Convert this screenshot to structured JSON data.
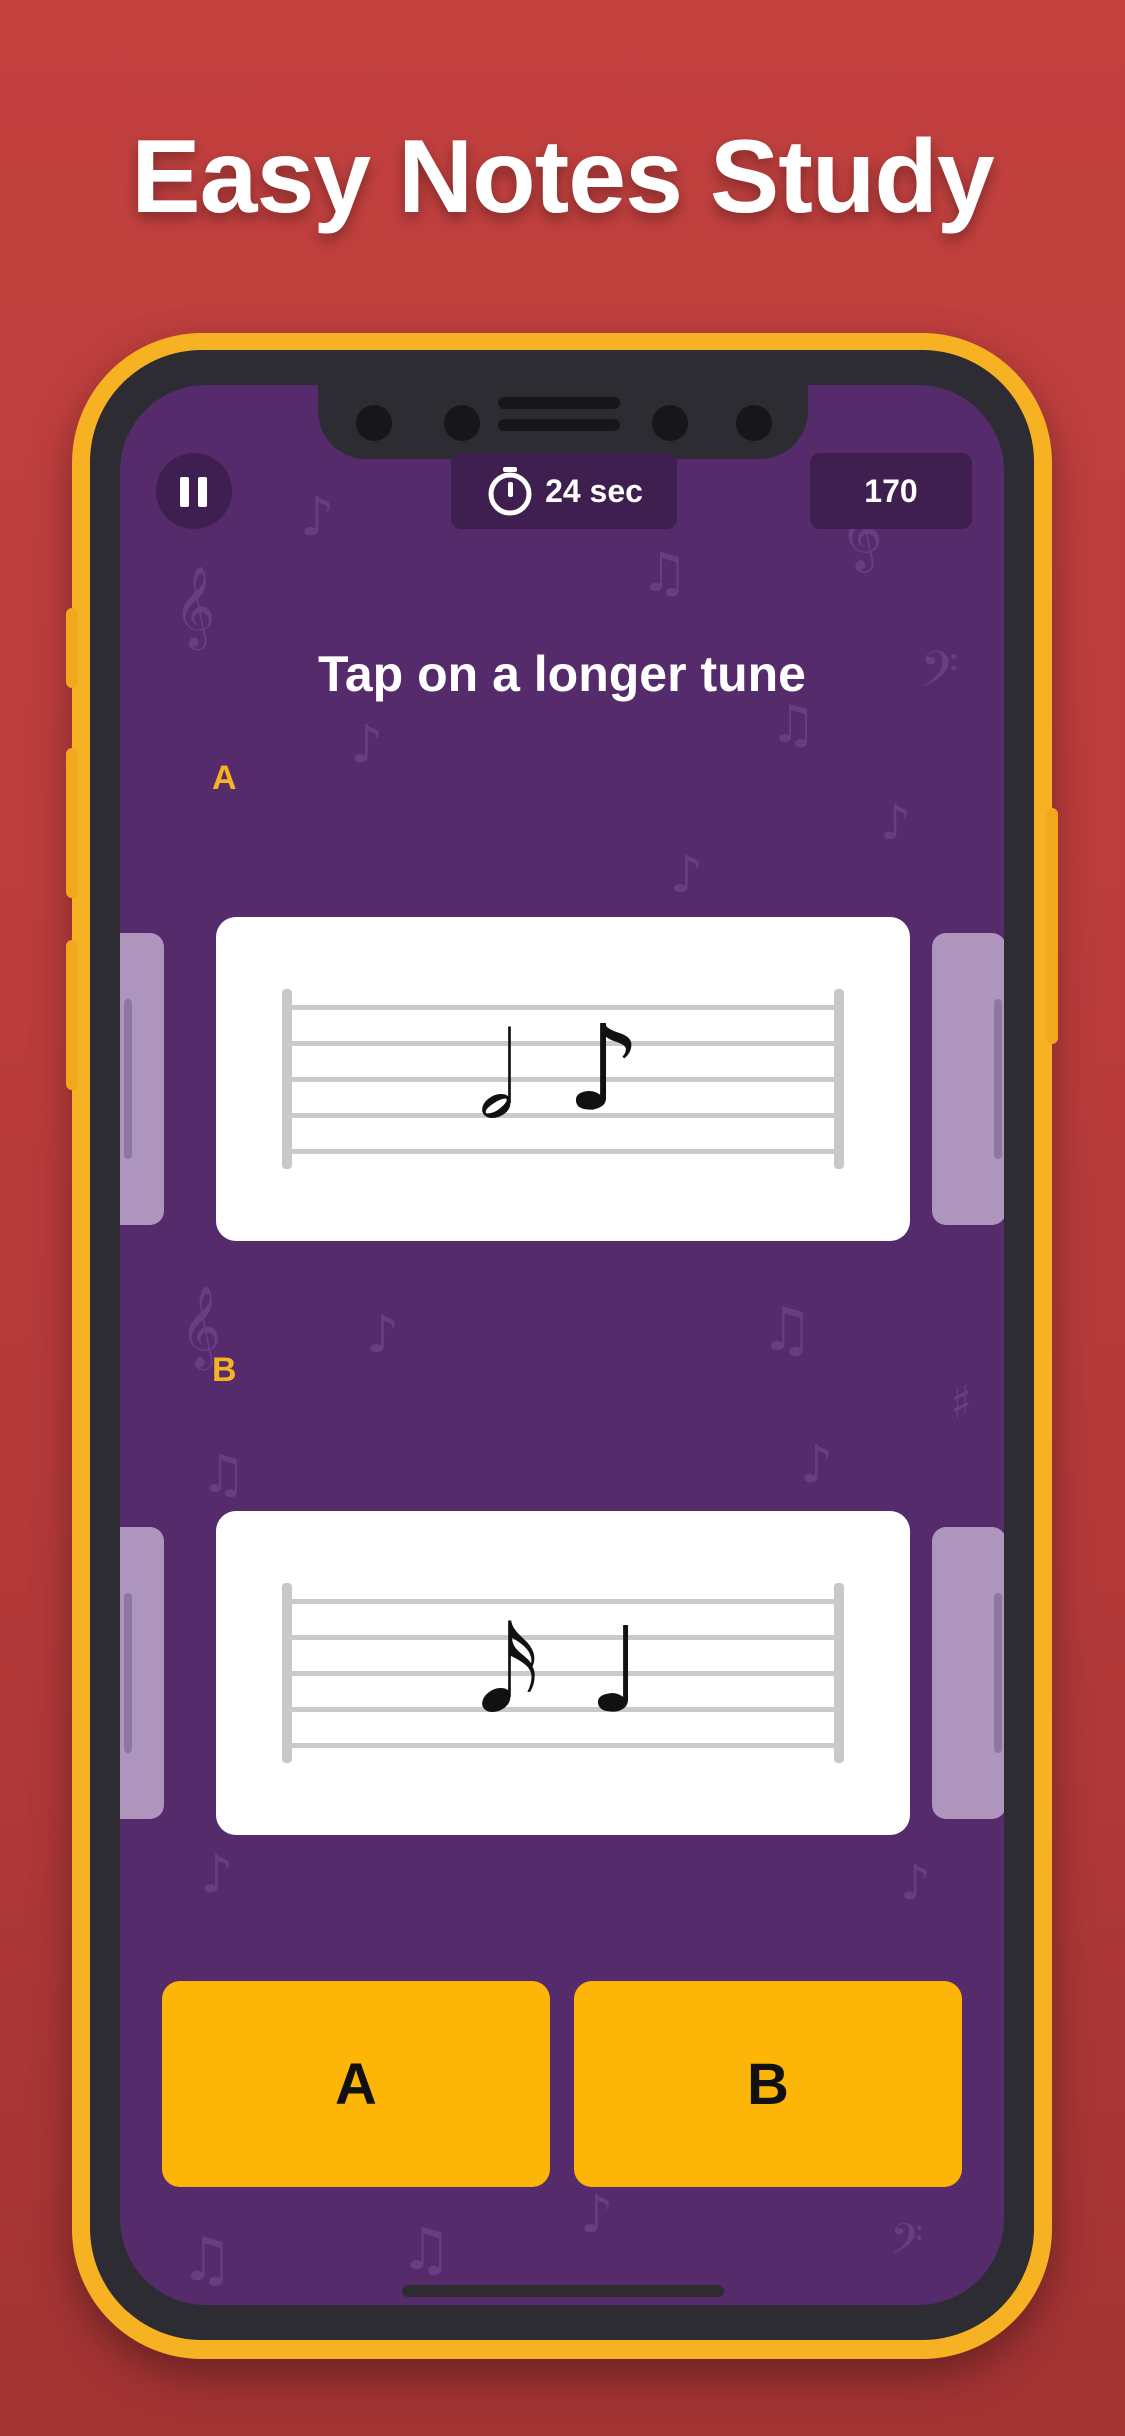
{
  "promo": {
    "title": "Easy Notes Study"
  },
  "hud": {
    "timer_text": "24 sec",
    "score": "170"
  },
  "question": {
    "prompt": "Tap on a longer tune"
  },
  "options": [
    {
      "label": "A",
      "notes": [
        "𝅗𝅥",
        "♪"
      ]
    },
    {
      "label": "B",
      "notes": [
        "𝅘𝅥𝅯",
        "♩"
      ]
    }
  ],
  "answers": {
    "a_label": "A",
    "b_label": "B"
  },
  "colors": {
    "background": "#C2413F",
    "phone_frame": "#F6B223",
    "screen": "#562B6C",
    "accent": "#F6B223",
    "answer_button": "#FDB607"
  }
}
